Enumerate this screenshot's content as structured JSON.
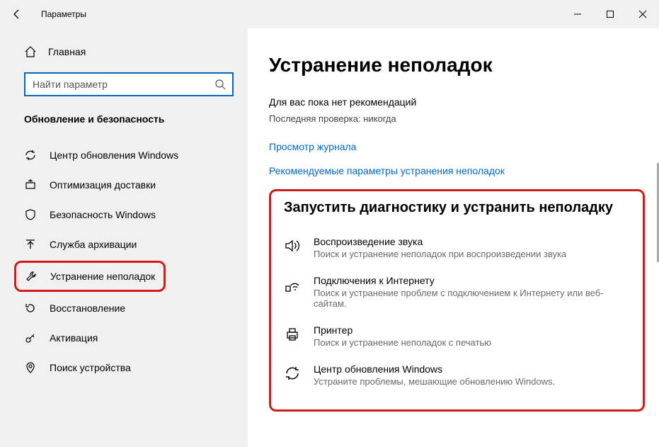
{
  "window": {
    "title": "Параметры"
  },
  "sidebar": {
    "home_label": "Главная",
    "search_placeholder": "Найти параметр",
    "group_header": "Обновление и безопасность",
    "items": [
      {
        "label": "Центр обновления Windows"
      },
      {
        "label": "Оптимизация доставки"
      },
      {
        "label": "Безопасность Windows"
      },
      {
        "label": "Служба архивации"
      },
      {
        "label": "Устранение неполадок"
      },
      {
        "label": "Восстановление"
      },
      {
        "label": "Активация"
      },
      {
        "label": "Поиск устройства"
      }
    ]
  },
  "main": {
    "title": "Устранение неполадок",
    "no_recs": "Для вас пока нет рекомендаций",
    "last_check": "Последняя проверка: никогда",
    "link_history": "Просмотр журнала",
    "link_recommended": "Рекомендуемые параметры устранения неполадок",
    "diag_title": "Запустить диагностику и устранить неполадку",
    "troubleshooters": [
      {
        "label": "Воспроизведение звука",
        "desc": "Поиск и устранение неполадок при воспроизведении звука"
      },
      {
        "label": "Подключения к Интернету",
        "desc": "Поиск и устранение проблем с подключением к Интернету или веб-сайтам."
      },
      {
        "label": "Принтер",
        "desc": "Поиск и устранение неполадок с печатью"
      },
      {
        "label": "Центр обновления Windows",
        "desc": "Устраните проблемы, мешающие обновлению Windows."
      }
    ]
  }
}
